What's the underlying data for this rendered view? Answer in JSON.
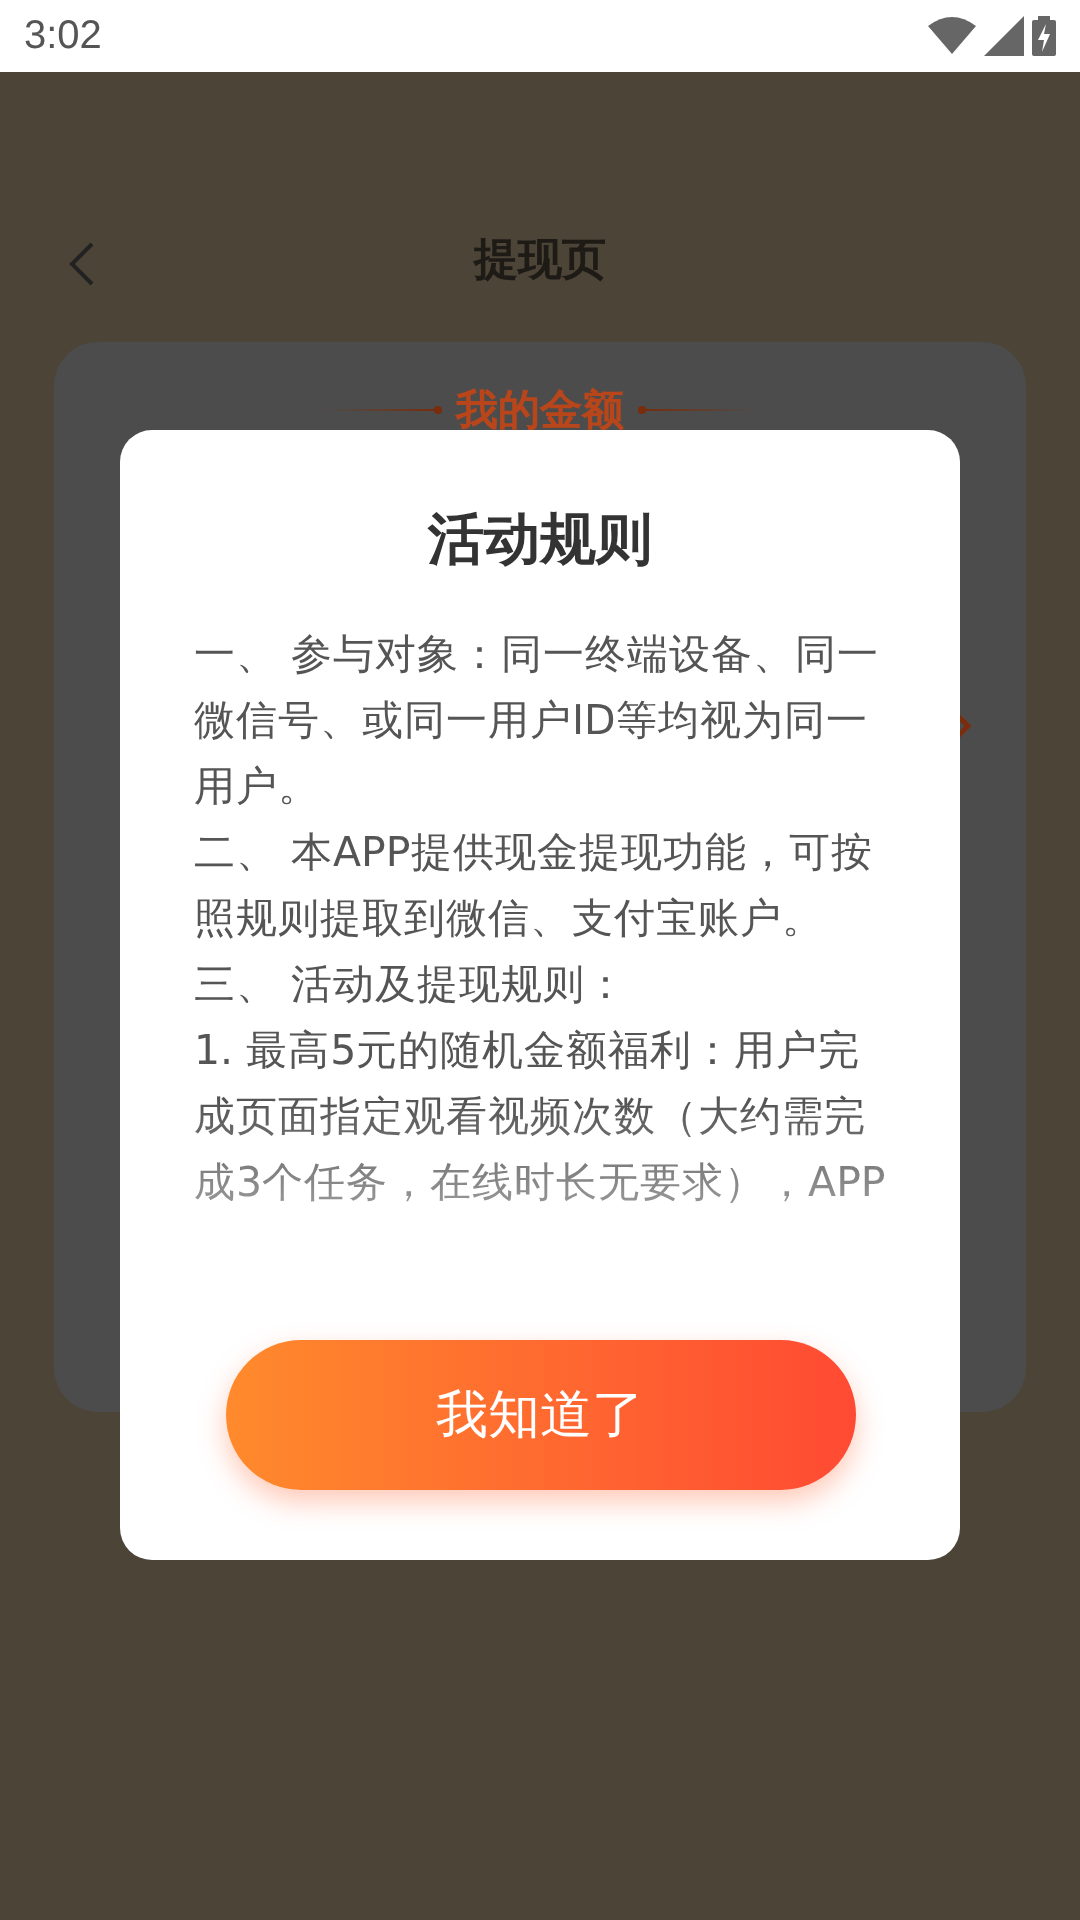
{
  "status_bar": {
    "time": "3:02"
  },
  "page": {
    "title": "提现页",
    "card_title": "我的金额"
  },
  "dialog": {
    "title": "活动规则",
    "paragraphs": [
      "一、 参与对象：同一终端设备、同一微信号、或同一用户ID等均视为同一用户。",
      "二、 本APP提供现金提现功能，可按照规则提取到微信、支付宝账户。",
      "三、 活动及提现规则：",
      "1. 最高5元的随机金额福利：用户完成页面指定观看视频次数（大约需完成3个任务，在线时长无要求），APP"
    ],
    "button": "我知道了"
  }
}
